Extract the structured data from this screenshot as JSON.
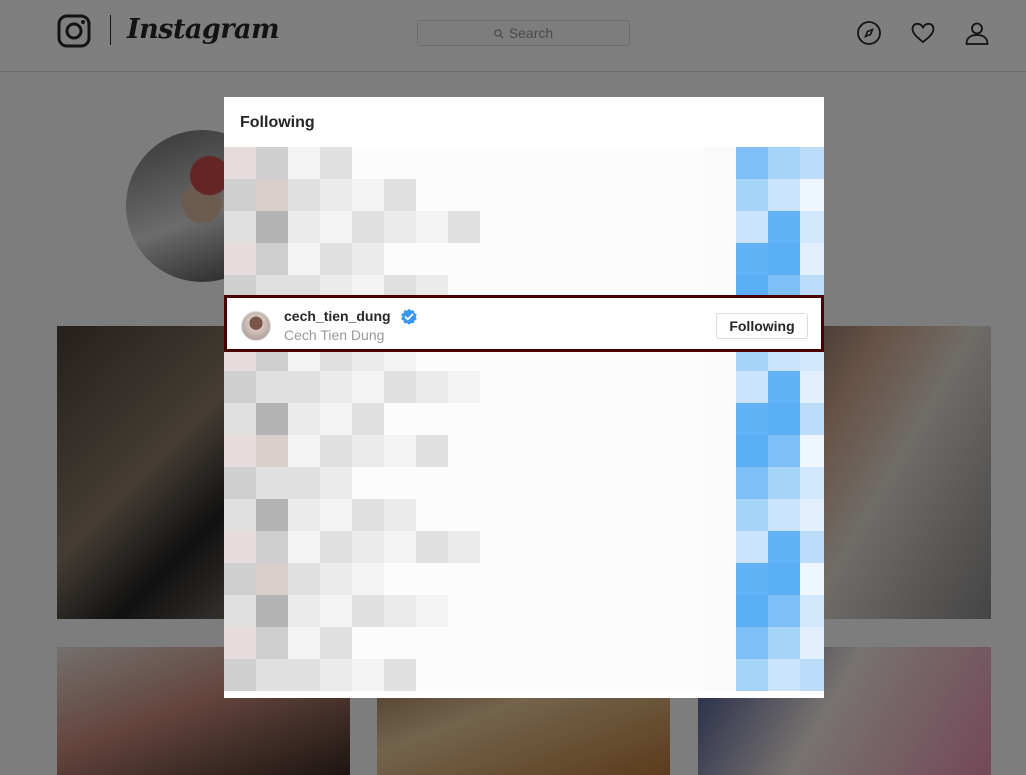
{
  "app": {
    "name": "Instagram"
  },
  "header": {
    "search_placeholder": "Search",
    "nav_icons": [
      "compass-icon",
      "heart-icon",
      "user-icon"
    ]
  },
  "modal": {
    "title": "Following",
    "highlighted_row": {
      "username": "cech_tien_dung",
      "full_name": "Cech Tien Dung",
      "verified": true,
      "button_label": "Following"
    }
  },
  "colors": {
    "highlight_border": "#4a0000",
    "verified_blue": "#3897f0",
    "text_primary": "#262626",
    "text_secondary": "#999999"
  }
}
